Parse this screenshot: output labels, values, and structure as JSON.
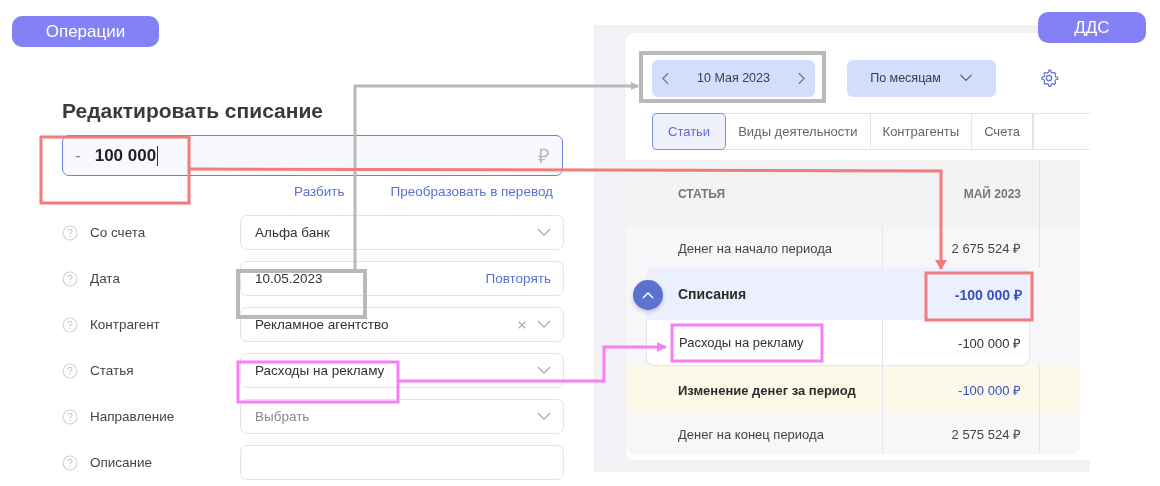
{
  "badges": [
    {
      "label": "Операции"
    },
    {
      "label": "ДДС"
    }
  ],
  "form": {
    "title": "Редактировать списание",
    "amount": {
      "sign": "-",
      "value": "100 000",
      "currency": "₽"
    },
    "links": [
      "Разбить",
      "Преобразовать в перевод"
    ],
    "fields": [
      {
        "label": "Со счета",
        "kind": "select",
        "value": "Альфа банк"
      },
      {
        "label": "Дата",
        "kind": "date",
        "value": "10.05.2023",
        "action": "Повторять"
      },
      {
        "label": "Контрагент",
        "kind": "select",
        "value": "Рекламное агентство",
        "clearable": true
      },
      {
        "label": "Статья",
        "kind": "select",
        "value": "Расходы на рекламу"
      },
      {
        "label": "Направление",
        "kind": "select",
        "placeholder": "Выбрать"
      },
      {
        "label": "Описание",
        "kind": "text"
      }
    ]
  },
  "report": {
    "date": "10 Мая 2023",
    "period": "По месяцам",
    "tabs": [
      {
        "label": "Статьи",
        "selected": true
      },
      {
        "label": "Виды деятельности",
        "selected": false
      },
      {
        "label": "Контрагенты",
        "selected": false
      },
      {
        "label": "Счета",
        "selected": false
      }
    ],
    "columns": [
      "СТАТЬЯ",
      "МАЙ 2023"
    ],
    "rows": [
      {
        "kind": "plain",
        "label": "Денег на начало периода",
        "value": "2 675 524 ₽"
      },
      {
        "kind": "group",
        "label": "Списания",
        "value": "-100 000 ₽",
        "expanded": true
      },
      {
        "kind": "child",
        "label": "Расходы на рекламу",
        "value": "-100 000 ₽"
      },
      {
        "kind": "total",
        "label": "Изменение денег за период",
        "value": "-100 000 ₽"
      },
      {
        "kind": "plain",
        "label": "Денег на конец периода",
        "value": "2 575 524 ₽"
      }
    ]
  }
}
